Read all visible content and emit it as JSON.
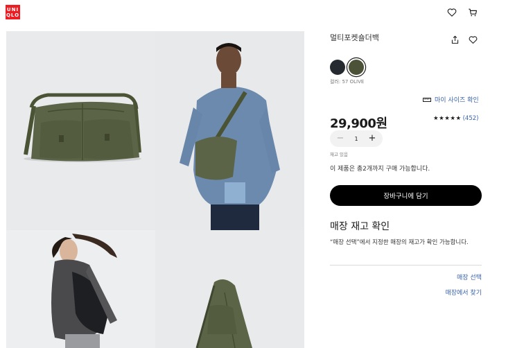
{
  "header": {
    "logo_line1": "UNI",
    "logo_line2": "QLO"
  },
  "product": {
    "name": "멀티포켓숄더백",
    "color_label": "컬러: 57 OLIVE",
    "swatches": [
      {
        "name": "navy",
        "color": "#252a30",
        "selected": false
      },
      {
        "name": "olive",
        "color": "#4b5238",
        "selected": true
      }
    ],
    "size_link": "마이 사이즈 확인",
    "price": "29,900원",
    "rating_stars": "★★★★★",
    "rating_count": "(452)",
    "quantity": "1",
    "minus": "−",
    "plus": "+",
    "stock_text": "재고 있음",
    "limit_text": "이 제품은 총2개까지 구매 가능합니다.",
    "add_to_cart": "장바구니에 담기"
  },
  "store": {
    "title": "매장 재고 확인",
    "description": "“매장 선택”에서 지정한 매장의 재고가 확인 가능합니다.",
    "select_store": "매장 선택",
    "find_store": "매장에서 찾기"
  },
  "colors": {
    "brand": "#ed1d24",
    "link": "#3a63a8",
    "button": "#000000"
  }
}
